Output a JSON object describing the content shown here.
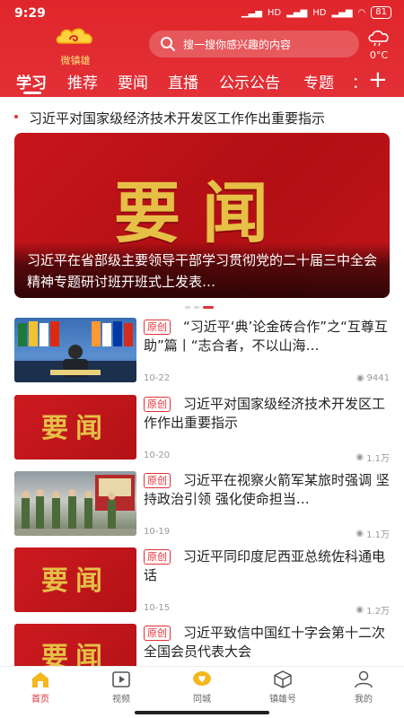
{
  "status": {
    "time": "9:29",
    "net1": "HD",
    "net2": "HD",
    "battery": "81"
  },
  "app": {
    "logo_text": "微镇雄"
  },
  "search": {
    "placeholder": "搜一搜你感兴趣的内容"
  },
  "weather": {
    "temp": "0°C"
  },
  "tabs": [
    {
      "label": "学习",
      "active": true
    },
    {
      "label": "推荐"
    },
    {
      "label": "要闻"
    },
    {
      "label": "直播"
    },
    {
      "label": "公示公告"
    },
    {
      "label": "专题"
    },
    {
      "label": "："
    }
  ],
  "ticker": {
    "text": "习近平对国家级经济技术开发区工作作出重要指示"
  },
  "banner": {
    "image_text": "要闻",
    "caption": "习近平在省部级主要领导干部学习贯彻党的二十届三中全会精神专题研讨班开班式上发表…"
  },
  "news": [
    {
      "badge": "原创",
      "title": "“习近平‘典’论金砖合作”之“互尊互助”篇丨“志合者，不以山海…",
      "date": "10-22",
      "views": "9441",
      "thumb": "summit"
    },
    {
      "badge": "原创",
      "title": "习近平对国家级经济技术开发区工作作出重要指示",
      "date": "10-20",
      "views": "1.1万",
      "thumb": "yw",
      "thumb_text": "要闻"
    },
    {
      "badge": "原创",
      "title": "习近平在视察火箭军某旅时强调 坚持政治引领 强化使命担当…",
      "date": "10-19",
      "views": "1.1万",
      "thumb": "troops"
    },
    {
      "badge": "原创",
      "title": "习近平同印度尼西亚总统佐科通电话",
      "date": "10-15",
      "views": "1.2万",
      "thumb": "yw",
      "thumb_text": "要闻"
    },
    {
      "badge": "原创",
      "title": "习近平致信中国红十字会第十二次全国会员代表大会",
      "date": "",
      "views": "",
      "thumb": "yw",
      "thumb_text": "要闻"
    }
  ],
  "nav": [
    {
      "label": "首页",
      "icon": "home-icon",
      "active": true
    },
    {
      "label": "视频",
      "icon": "video-icon"
    },
    {
      "label": "同城",
      "icon": "chat-heart-icon"
    },
    {
      "label": "镇雄号",
      "icon": "cube-icon"
    },
    {
      "label": "我的",
      "icon": "user-icon"
    }
  ],
  "colors": {
    "brand": "#e23036",
    "gold": "#e6c046",
    "text": "#222222",
    "muted": "#999999"
  }
}
